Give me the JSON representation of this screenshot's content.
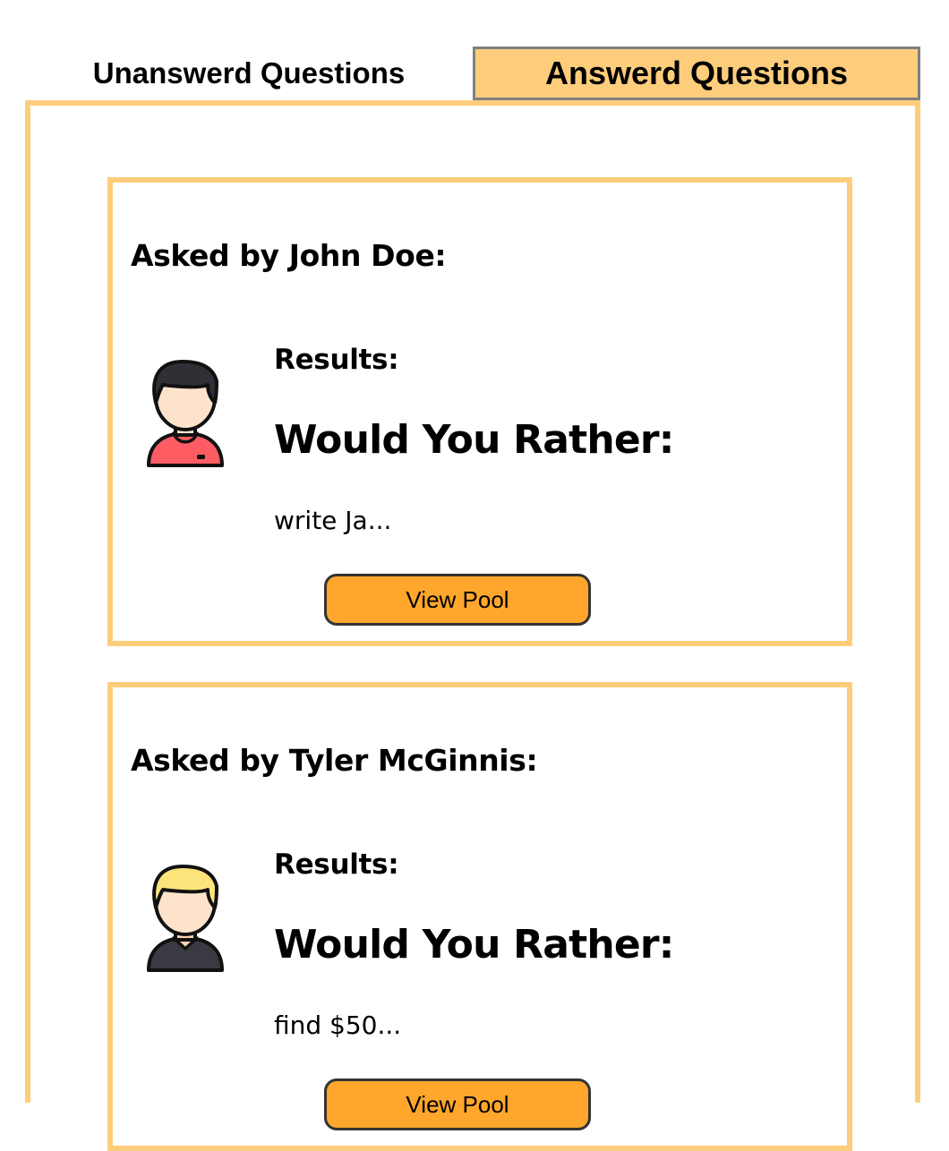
{
  "tabs": {
    "unanswered_label": "Unanswerd Questions",
    "answered_label": "Answerd Questions",
    "active": "answered"
  },
  "colors": {
    "accent_border": "#fecd7c",
    "active_tab_bg": "#fecd7c",
    "button_bg": "#ffa62d",
    "tab_border": "#808080"
  },
  "questions": [
    {
      "asked_by": "Asked by John Doe:",
      "avatar_icon": "man-dark-hair-red-shirt-icon",
      "results_label": "Results:",
      "title": "Would You Rather:",
      "option_snippet": "write Ja...",
      "button_label": "View Pool"
    },
    {
      "asked_by": "Asked by Tyler McGinnis:",
      "avatar_icon": "man-blonde-hair-dark-shirt-icon",
      "results_label": "Results:",
      "title": "Would You Rather:",
      "option_snippet": "find $50...",
      "button_label": "View Pool"
    }
  ]
}
